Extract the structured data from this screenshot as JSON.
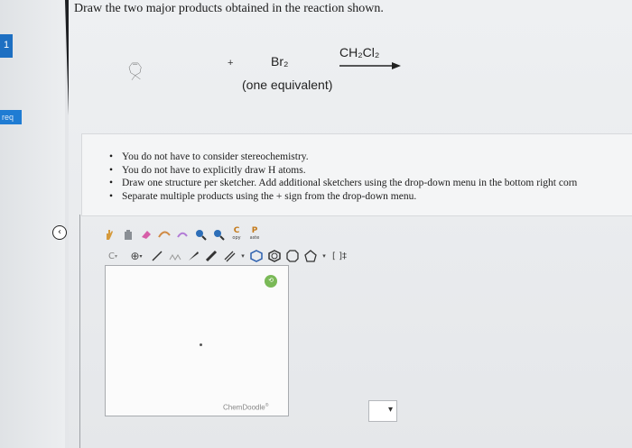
{
  "question": "Draw the two major products obtained in the reaction shown.",
  "reaction": {
    "plus": "+",
    "reagent": "Br₂",
    "reagent_note": "(one equivalent)",
    "solvent": "CH₂Cl₂"
  },
  "instructions": [
    "You do not have to consider stereochemistry.",
    "You do not have to explicitly draw H atoms.",
    "Draw one structure per sketcher. Add additional sketchers using the drop-down menu in the bottom right corn",
    "Separate multiple products using the + sign from the drop-down menu."
  ],
  "sidebar": {
    "req_label": "req",
    "marker": "1"
  },
  "editor": {
    "toolbar_row1": [
      "hand-icon",
      "clear-icon",
      "eraser-icon",
      "lasso-icon",
      "zoom-in-icon",
      "zoom-out-icon",
      "copy-icon",
      "paste-icon"
    ],
    "copy_label": "C",
    "copy_caption": "opy",
    "paste_label": "P",
    "paste_caption": "aste",
    "element_label": "C",
    "brackets_label": "[ ]‡",
    "brand": "ChemDoodle",
    "brand_mark": "®",
    "canvas_badge": "⟲"
  },
  "colors": {
    "accent_blue": "#1f7cd3",
    "dark_line": "#1d1f22",
    "badge_green": "#7ab957"
  }
}
